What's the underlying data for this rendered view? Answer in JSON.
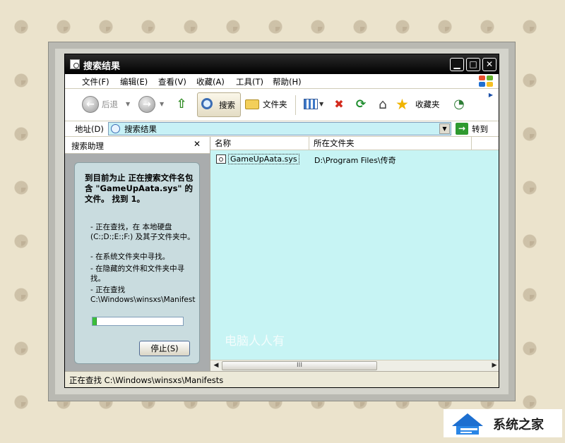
{
  "window": {
    "title": "搜索结果"
  },
  "title_buttons": {
    "minimize": "▁",
    "maximize": "□",
    "close": "✕"
  },
  "menu": [
    "文件(F)",
    "编辑(E)",
    "查看(V)",
    "收藏(A)",
    "工具(T)",
    "帮助(H)"
  ],
  "toolbar": {
    "back": "后退",
    "search": "搜索",
    "folders": "文件夹",
    "favorites": "收藏夹"
  },
  "address": {
    "label": "地址(D)",
    "value": "搜索结果",
    "go": "转到"
  },
  "search_pane": {
    "header": "搜索助理",
    "close": "✕",
    "title": "到目前为止 正在搜索文件名包含 \"GameUpAata.sys\" 的 文件。 找到 1。",
    "bullets": [
      "- 正在查找，在 本地硬盘 (C:;D:;E:;F:) 及其子文件夹中。",
      "- 在系统文件夹中寻找。",
      "- 在隐藏的文件和文件夹中寻找。",
      "- 正在查找 C:\\Windows\\winsxs\\Manifest"
    ],
    "progress": 0.05,
    "stop": "停止(S)"
  },
  "columns": {
    "name": "名称",
    "folder": "所在文件夹"
  },
  "results": [
    {
      "name": "GameUpAata.sys",
      "folder": "D:\\Program Files\\传奇"
    }
  ],
  "watermark": "电脑人人有",
  "scrollbar": {
    "left": "◀",
    "right": "▶",
    "grip": "III"
  },
  "status": "正在查找 C:\\Windows\\winsxs\\Manifests",
  "brand": {
    "text": "系统之家"
  }
}
